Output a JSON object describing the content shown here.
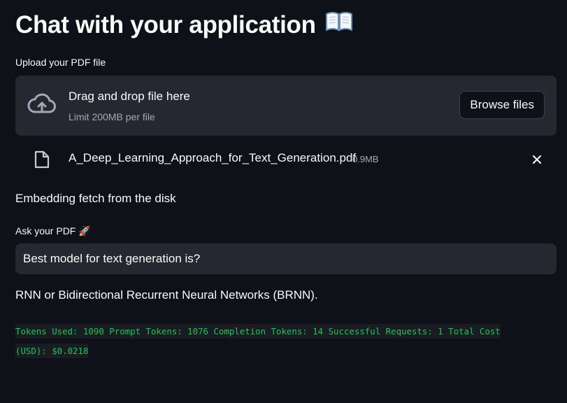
{
  "header": {
    "title": "Chat with your application",
    "title_icon": "open-book-icon"
  },
  "uploader": {
    "label": "Upload your PDF file",
    "drop_text": "Drag and drop file here",
    "limit_text": "Limit 200MB per file",
    "browse_label": "Browse files",
    "cloud_icon": "cloud-upload-icon"
  },
  "file": {
    "name": "A_Deep_Learning_Approach_for_Text_Generation.pdf",
    "size": "0.9MB",
    "icon": "file-icon",
    "remove_icon": "close-icon"
  },
  "status": {
    "text": "Embedding fetch from the disk"
  },
  "question": {
    "label": "Ask your PDF 🚀",
    "value": "Best model for text generation is?"
  },
  "answer": {
    "text": "RNN or Bidirectional Recurrent Neural Networks (BRNN)."
  },
  "usage": {
    "text": "Tokens Used: 1090 Prompt Tokens: 1076 Completion Tokens: 14 Successful Requests: 1 Total Cost (USD): $0.0218"
  },
  "colors": {
    "background": "#0e1117",
    "panel": "#262730",
    "code_text": "#21c354",
    "muted_text": "#a3a8b8"
  }
}
